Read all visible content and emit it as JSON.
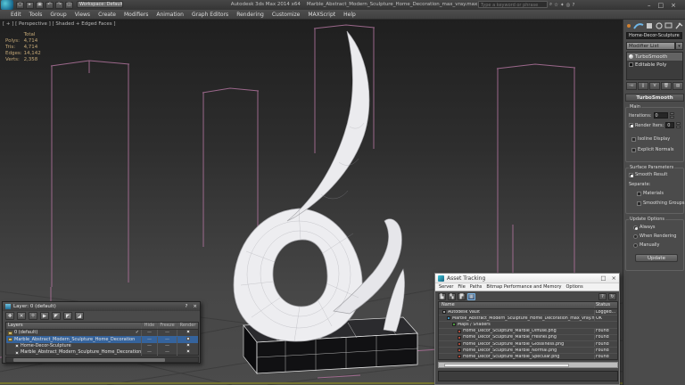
{
  "titlebar": {
    "app_title": "Autodesk 3ds Max 2014 x64",
    "doc_title": "Marble_Abstract_Modern_Sculpture_Home_Decoration_max_vray.max",
    "workspace": "Workspace: Default",
    "search_placeholder": "Type a keyword or phrase",
    "minimize": "–",
    "maximize": "□",
    "close": "×"
  },
  "menubar": {
    "items": [
      "Edit",
      "Tools",
      "Group",
      "Views",
      "Create",
      "Modifiers",
      "Animation",
      "Graph Editors",
      "Rendering",
      "Customize",
      "MAXScript",
      "Help"
    ]
  },
  "viewport": {
    "label": "[ + ] [ Perspective ] [ Shaded + Edged Faces ]",
    "stats": {
      "total_label": "Total",
      "rows": [
        {
          "name": "Polys:",
          "value": "4,714"
        },
        {
          "name": "Tris:",
          "value": "4,714"
        },
        {
          "name": "Edges:",
          "value": "14,142"
        },
        {
          "name": "Verts:",
          "value": "2,358"
        }
      ]
    }
  },
  "command_panel": {
    "object_name": "Home-Decor-Sculpture",
    "modifier_list": "Modifier List",
    "stack": [
      {
        "label": "TurboSmooth"
      },
      {
        "label": "Editable Poly"
      }
    ],
    "rollout_title": "TurboSmooth",
    "main": {
      "title": "Main",
      "iterations_label": "Iterations:",
      "iterations_value": "0",
      "render_iters_label": "Render Iters:",
      "render_iters_value": "0",
      "isoline_label": "Isoline Display",
      "explicit_label": "Explicit Normals"
    },
    "surface": {
      "title": "Surface Parameters",
      "smooth_result_label": "Smooth Result",
      "separate_label": "Separate:",
      "materials_label": "Materials",
      "smoothing_label": "Smoothing Groups"
    },
    "update": {
      "title": "Update Options",
      "always_label": "Always",
      "when_label": "When Rendering",
      "manually_label": "Manually",
      "button_label": "Update"
    }
  },
  "layer_dialog": {
    "title": "Layer:  0 (default)",
    "help": "?",
    "close": "×",
    "columns": {
      "layers": "Layers",
      "hide": "Hide",
      "freeze": "Freeze",
      "render": "Render"
    },
    "rows": [
      {
        "label": "0 (default)",
        "current": "✓",
        "hide": "—",
        "freeze": "—"
      },
      {
        "label": "Marble_Abstract_Modern_Sculpture_Home_Decoration",
        "current": "",
        "hide": "—",
        "freeze": "—"
      },
      {
        "label": "Home-Decor-Sculpture",
        "current": "",
        "hide": "—",
        "freeze": "—"
      },
      {
        "label": "Marble_Abstract_Modern_Sculpture_Home_Decoration",
        "current": "",
        "hide": "—",
        "freeze": "—"
      }
    ]
  },
  "asset_dialog": {
    "title": "Asset Tracking",
    "maximize": "□",
    "close": "×",
    "menus": [
      "Server",
      "File",
      "Paths",
      "Bitmap Performance and Memory",
      "Options"
    ],
    "columns": {
      "name": "Name",
      "status": "Status"
    },
    "rows": [
      {
        "label": "Autodesk Vault",
        "status": "Logged..."
      },
      {
        "label": "Marble_Abstract_Modern_Sculpture_Home_Decoration_max_vray.max",
        "status": "OK"
      },
      {
        "label": "Maps / Shaders",
        "status": ""
      },
      {
        "label": "Home_Decor_Sculpture_Marble_Diffuse.png",
        "status": "Found"
      },
      {
        "label": "Home_Decor_Sculpture_Marble_Fresnel.png",
        "status": "Found"
      },
      {
        "label": "Home_Decor_Sculpture_Marble_Glossiness.png",
        "status": "Found"
      },
      {
        "label": "Home_Decor_Sculpture_Marble_Normal.png",
        "status": "Found"
      },
      {
        "label": "Home_Decor_Sculpture_Marble_Specular.png",
        "status": "Found"
      }
    ]
  },
  "colors": {
    "group_selection_pink": "#a86f96",
    "selected_row_blue": "#35639c",
    "stats_text": "#c4a877",
    "active_viewport_line": "#73732f"
  }
}
